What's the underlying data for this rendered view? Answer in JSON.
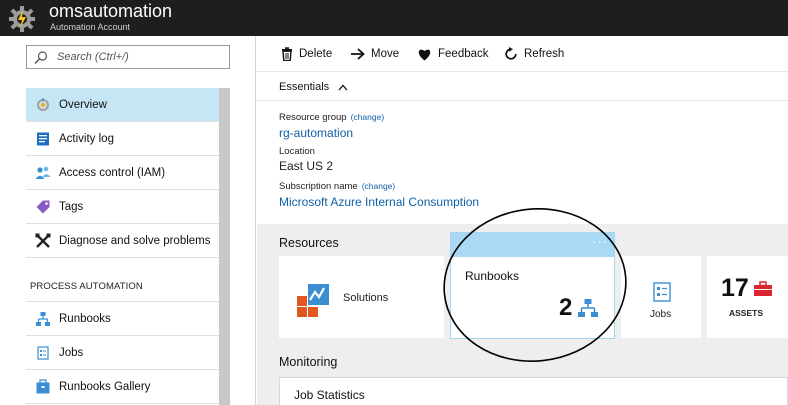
{
  "header": {
    "title": "omsautomation",
    "subtitle": "Automation Account",
    "background": "#1e1e1e"
  },
  "sidebar": {
    "search": {
      "placeholder": "Search (Ctrl+/)",
      "value": ""
    },
    "items": [
      {
        "label": "Overview",
        "icon": "overview-icon",
        "active": true
      },
      {
        "label": "Activity log",
        "icon": "activity-log-icon"
      },
      {
        "label": "Access control (IAM)",
        "icon": "access-control-icon"
      },
      {
        "label": "Tags",
        "icon": "tag-icon"
      },
      {
        "label": "Diagnose and solve problems",
        "icon": "wrench-icon"
      }
    ],
    "section_header": "PROCESS AUTOMATION",
    "automation_items": [
      {
        "label": "Runbooks",
        "icon": "runbooks-icon"
      },
      {
        "label": "Jobs",
        "icon": "jobs-icon"
      },
      {
        "label": "Runbooks Gallery",
        "icon": "gallery-icon"
      }
    ],
    "active_color": "#c7e6f5"
  },
  "toolbar": {
    "delete_label": "Delete",
    "move_label": "Move",
    "feedback_label": "Feedback",
    "refresh_label": "Refresh"
  },
  "essentials": {
    "label": "Essentials",
    "resource_group": {
      "label": "Resource group",
      "change": "(change)",
      "value": "rg-automation"
    },
    "location": {
      "label": "Location",
      "value": "East US 2"
    },
    "subscription": {
      "label": "Subscription name",
      "change": "(change)",
      "value": "Microsoft Azure Internal Consumption"
    }
  },
  "resources": {
    "title": "Resources",
    "tiles": {
      "solutions": {
        "label": "Solutions"
      },
      "runbooks": {
        "label": "Runbooks",
        "count": "2",
        "dots": "···"
      },
      "jobs": {
        "label": "Jobs"
      },
      "assets": {
        "label": "ASSETS",
        "count": "17"
      }
    }
  },
  "monitoring": {
    "title": "Monitoring",
    "job_statistics": "Job Statistics"
  },
  "colors": {
    "link": "#1060a8",
    "accent_orange": "#e0571f",
    "accent_blue": "#3a8ed1",
    "tile_header": "#a9d9f4",
    "assets_red": "#d9262f"
  }
}
